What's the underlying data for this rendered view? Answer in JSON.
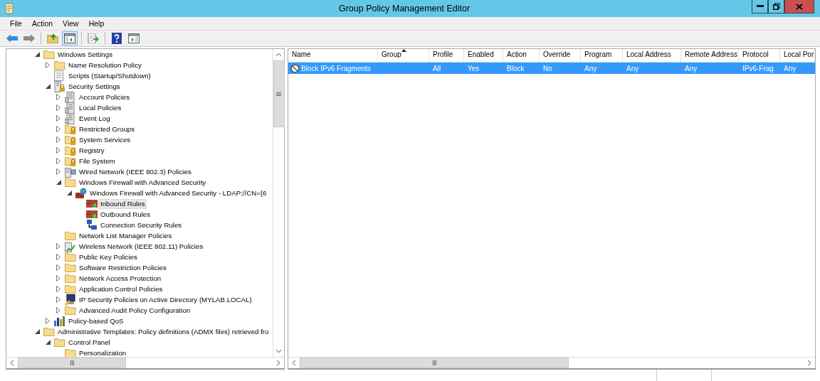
{
  "window": {
    "title": "Group Policy Management Editor"
  },
  "menu": [
    "File",
    "Action",
    "View",
    "Help"
  ],
  "toolbar": [
    {
      "kind": "back",
      "pressed": false
    },
    {
      "kind": "forward",
      "pressed": false
    },
    {
      "kind": "up",
      "pressed": false
    },
    {
      "kind": "tree",
      "pressed": true
    },
    {
      "kind": "export",
      "pressed": false
    },
    {
      "kind": "help",
      "pressed": false
    },
    {
      "kind": "pane",
      "pressed": false
    }
  ],
  "tree": [
    {
      "label": "Windows Settings",
      "kind": "folder",
      "expanded": true,
      "selected": false,
      "children": [
        {
          "label": "Name Resolution Policy",
          "kind": "folder",
          "expanded": false,
          "selected": false
        },
        {
          "label": "Scripts (Startup/Shutdown)",
          "kind": "scripts",
          "selected": false
        },
        {
          "label": "Security Settings",
          "kind": "security",
          "expanded": true,
          "selected": false,
          "children": [
            {
              "label": "Account Policies",
              "kind": "policy",
              "expanded": false,
              "selected": false
            },
            {
              "label": "Local Policies",
              "kind": "policy",
              "expanded": false,
              "selected": false
            },
            {
              "label": "Event Log",
              "kind": "policy",
              "expanded": false,
              "selected": false
            },
            {
              "label": "Restricted Groups",
              "kind": "lockfolder",
              "expanded": false,
              "selected": false
            },
            {
              "label": "System Services",
              "kind": "lockfolder",
              "expanded": false,
              "selected": false
            },
            {
              "label": "Registry",
              "kind": "lockfolder",
              "expanded": false,
              "selected": false
            },
            {
              "label": "File System",
              "kind": "lockfolder",
              "expanded": false,
              "selected": false
            },
            {
              "label": "Wired Network (IEEE 802.3) Policies",
              "kind": "wired",
              "expanded": false,
              "selected": false
            },
            {
              "label": "Windows Firewall with Advanced Security",
              "kind": "folder",
              "expanded": true,
              "selected": false,
              "children": [
                {
                  "label": "Windows Firewall with Advanced Security - LDAP://CN={6",
                  "kind": "firewall",
                  "expanded": true,
                  "selected": false,
                  "children": [
                    {
                      "label": "Inbound Rules",
                      "kind": "rules",
                      "selected": true
                    },
                    {
                      "label": "Outbound Rules",
                      "kind": "rules",
                      "selected": false
                    },
                    {
                      "label": "Connection Security Rules",
                      "kind": "connection",
                      "selected": false
                    }
                  ]
                }
              ]
            },
            {
              "label": "Network List Manager Policies",
              "kind": "folder",
              "selected": false
            },
            {
              "label": "Wireless Network (IEEE 802.11) Policies",
              "kind": "wireless",
              "expanded": false,
              "selected": false
            },
            {
              "label": "Public Key Policies",
              "kind": "folder",
              "expanded": false,
              "selected": false
            },
            {
              "label": "Software Restriction Policies",
              "kind": "folder",
              "expanded": false,
              "selected": false
            },
            {
              "label": "Network Access Protection",
              "kind": "folder",
              "expanded": false,
              "selected": false
            },
            {
              "label": "Application Control Policies",
              "kind": "folder",
              "expanded": false,
              "selected": false
            },
            {
              "label": "IP Security Policies on Active Directory (MYLAB.LOCAL)",
              "kind": "ipsec",
              "expanded": false,
              "selected": false
            },
            {
              "label": "Advanced Audit Policy Configuration",
              "kind": "folder",
              "expanded": false,
              "selected": false
            }
          ]
        },
        {
          "label": "Policy-based QoS",
          "kind": "qos",
          "expanded": false,
          "selected": false
        }
      ]
    },
    {
      "label": "Administrative Templates: Policy definitions (ADMX files) retrieved fro",
      "kind": "folder",
      "expanded": true,
      "selected": false,
      "children": [
        {
          "label": "Control Panel",
          "kind": "folder",
          "expanded": true,
          "selected": false,
          "children": [
            {
              "label": "Personalization",
              "kind": "folder",
              "selected": false
            }
          ]
        }
      ]
    }
  ],
  "table": {
    "columns": [
      {
        "label": "Name",
        "sorted": false
      },
      {
        "label": "Group",
        "sorted": true
      },
      {
        "label": "Profile",
        "sorted": false
      },
      {
        "label": "Enabled",
        "sorted": false
      },
      {
        "label": "Action",
        "sorted": false
      },
      {
        "label": "Override",
        "sorted": false
      },
      {
        "label": "Program",
        "sorted": false
      },
      {
        "label": "Local Address",
        "sorted": false
      },
      {
        "label": "Remote Address",
        "sorted": false
      },
      {
        "label": "Protocol",
        "sorted": false
      },
      {
        "label": "Local Por",
        "sorted": false
      }
    ],
    "rows": [
      {
        "selected": true,
        "cells": [
          "Block IPv6 Fragments",
          "",
          "All",
          "Yes",
          "Block",
          "No",
          "Any",
          "Any",
          "Any",
          "IPv6-Frag",
          "Any"
        ]
      }
    ]
  }
}
